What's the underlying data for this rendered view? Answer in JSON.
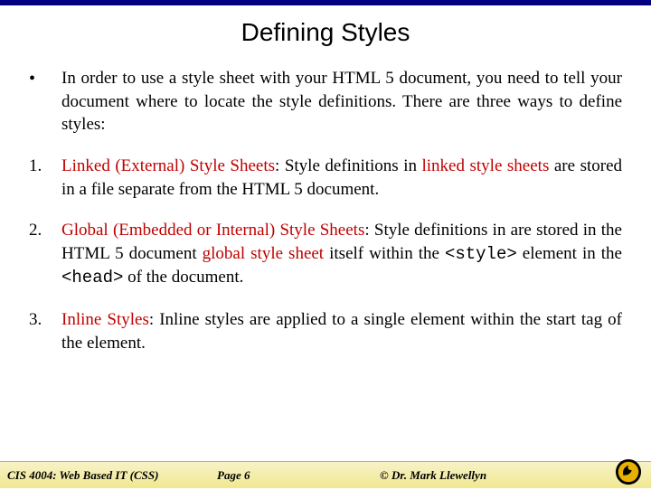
{
  "title": "Defining Styles",
  "bullet": {
    "mark": "•",
    "text": "In order to use a style sheet with your HTML 5 document, you need to tell your document where to locate the style definitions.  There are three ways to define styles:"
  },
  "items": [
    {
      "num": "1.",
      "lead": "Linked (External) Style Sheets",
      "after_lead": ": Style definitions in ",
      "red1": "linked style sheets",
      "tail": " are stored in a file separate from the HTML 5 document."
    },
    {
      "num": "2.",
      "lead": "Global (Embedded or Internal) Style Sheets",
      "after_lead": ":  Style definitions in are stored in the HTML 5 document ",
      "red1": "global style sheet",
      "mid1": " itself within the ",
      "code1": "<style>",
      "mid2": " element in the ",
      "code2": "<head>",
      "tail": " of the document."
    },
    {
      "num": "3.",
      "lead": "Inline Styles",
      "after_lead": ": Inline styles are applied to a single element within the start tag of the element.",
      "red1": "",
      "tail": ""
    }
  ],
  "footer": {
    "left": "CIS 4004: Web Based IT (CSS)",
    "mid": "Page 6",
    "right": "© Dr. Mark Llewellyn"
  }
}
